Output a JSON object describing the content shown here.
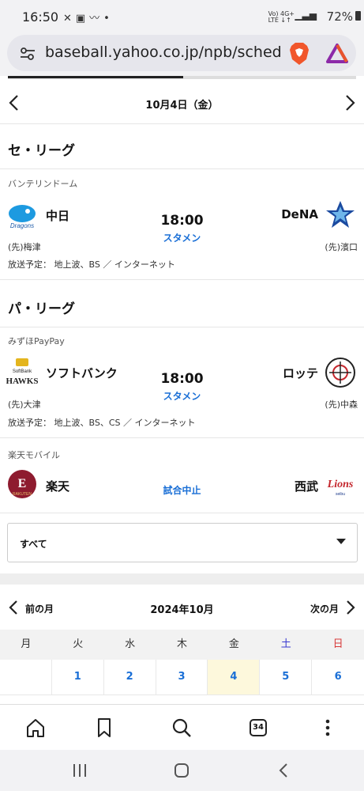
{
  "status": {
    "time": "16:50",
    "battery": "72%",
    "network": "Vo) 4G+\nLTE ↓↑"
  },
  "browser": {
    "url": "baseball.yahoo.co.jp/npb/schedule"
  },
  "date_nav": {
    "title": "10月4日（金）"
  },
  "central": {
    "title": "セ・リーグ",
    "venue": "バンテリンドーム",
    "home_team": "中日",
    "away_team": "DeNA",
    "time": "18:00",
    "lineup": "スタメン",
    "home_pitcher": "(先)梅津",
    "away_pitcher": "(先)濱口",
    "broadcast": "放送予定： 地上波、BS ／ インターネット"
  },
  "pacific": {
    "title": "パ・リーグ",
    "game1": {
      "venue": "みずほPayPay",
      "home_team": "ソフトバンク",
      "away_team": "ロッテ",
      "time": "18:00",
      "lineup": "スタメン",
      "home_pitcher": "(先)大津",
      "away_pitcher": "(先)中森",
      "broadcast": "放送予定： 地上波、BS、CS ／ インターネット"
    },
    "game2": {
      "venue": "楽天モバイル",
      "home_team": "楽天",
      "away_team": "西武",
      "status": "試合中止"
    }
  },
  "filter": {
    "selected": "すべて"
  },
  "calendar": {
    "prev_label": "前の月",
    "title": "2024年10月",
    "next_label": "次の月",
    "weekdays": [
      "月",
      "火",
      "水",
      "木",
      "金",
      "土",
      "日"
    ],
    "week1": [
      "",
      "1",
      "2",
      "3",
      "4",
      "5",
      "6"
    ],
    "highlight_color": "#fdf8dc",
    "saturday_color": "#3a3ad0",
    "sunday_color": "#d83a3a"
  },
  "bottom_nav": {
    "tab_count": "34"
  },
  "colors": {
    "accent": "#1a6fd6"
  }
}
